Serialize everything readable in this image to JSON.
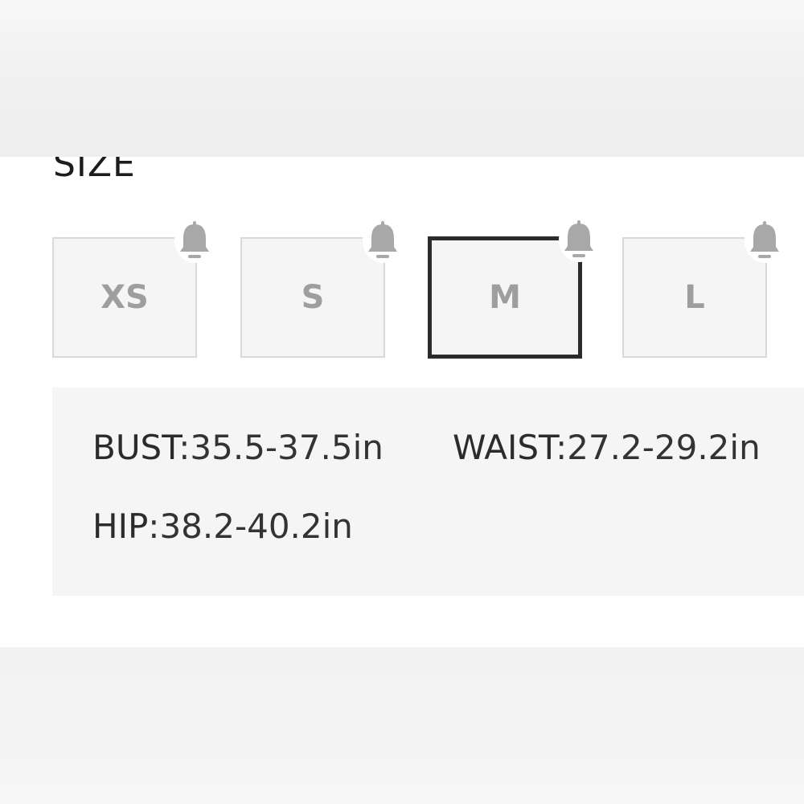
{
  "section_title": "SIZE",
  "sizes": [
    {
      "label": "XS",
      "selected": false
    },
    {
      "label": "S",
      "selected": false
    },
    {
      "label": "M",
      "selected": true
    },
    {
      "label": "L",
      "selected": false
    }
  ],
  "notify_icon": "bell-icon",
  "measurements": {
    "bust": {
      "key": "BUST",
      "value": ":35.5-37.5in"
    },
    "waist": {
      "key": "WAIST",
      "value": ":27.2-29.2in"
    },
    "hip": {
      "key": "HIP",
      "value": ":38.2-40.2in"
    }
  },
  "colors": {
    "selected_border": "#2b2b2b",
    "option_border": "#d9d9d9",
    "option_bg": "#f5f5f5",
    "option_text": "#9e9e9e",
    "bell": "#a8a8a8"
  }
}
